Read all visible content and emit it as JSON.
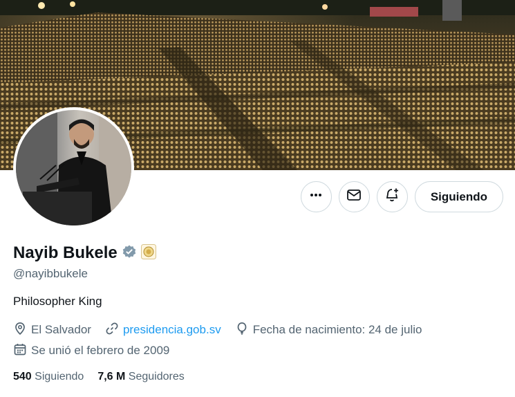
{
  "profile": {
    "name": "Nayib Bukele",
    "handle": "@nayibbukele",
    "bio": "Philosopher King",
    "location": "El Salvador",
    "website": "presidencia.gob.sv",
    "birthday": "Fecha de nacimiento: 24 de julio",
    "joined": "Se unió el febrero de 2009",
    "following_count": "540",
    "following_label": "Siguiendo",
    "followers_count": "7,6 M",
    "followers_label": "Seguidores"
  },
  "actions": {
    "follow_label": "Siguiendo"
  },
  "icons": {
    "more": "more-horizontal-icon",
    "message": "envelope-icon",
    "notify": "bell-plus-icon",
    "verified": "verified-badge-icon",
    "affiliation": "government-seal-icon",
    "location": "location-pin-icon",
    "link": "link-icon",
    "birthday": "balloon-icon",
    "calendar": "calendar-icon"
  },
  "colors": {
    "link": "#1d9bf0",
    "secondary_text": "#536471",
    "verified": "#829aab"
  }
}
